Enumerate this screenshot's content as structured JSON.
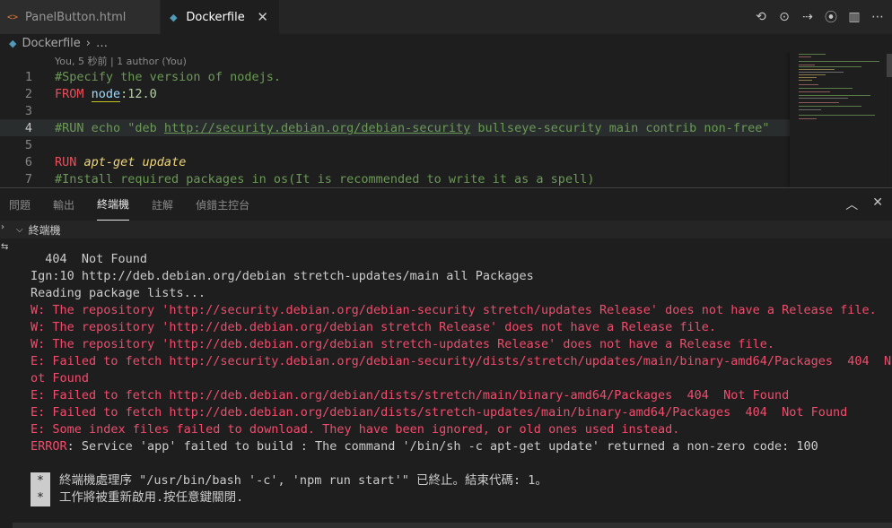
{
  "tabs": [
    {
      "label": "PanelButton.html",
      "icon": "html-icon",
      "active": false
    },
    {
      "label": "Dockerfile",
      "icon": "docker-icon",
      "active": true
    }
  ],
  "tab_close": "✕",
  "breadcrumb": {
    "file": "Dockerfile",
    "more": "…"
  },
  "editor": {
    "blame": "You, 5 秒前 | 1 author (You)",
    "line_numbers": [
      "1",
      "2",
      "3",
      "4",
      "5",
      "6",
      "7"
    ],
    "line1": "#Specify the version of nodejs.",
    "line2_kw": "FROM",
    "line2_image": "node",
    "line2_tag": ":12.0",
    "line4_pre": "#RUN echo \"deb ",
    "line4_link": "http://security.debian.org/debian-security",
    "line4_post": " bullseye-security main contrib non-free\"",
    "line6_kw": "RUN",
    "line6_cmd": "apt-get update",
    "line7": "#Install required packages in os(It is recommended to write it as a spell)"
  },
  "panel": {
    "tabs": [
      "問題",
      "輸出",
      "終端機",
      "註解",
      "偵錯主控台"
    ],
    "active_tab": "終端機",
    "terminal_title": "終端機"
  },
  "terminal": {
    "lines": [
      {
        "text": "  404  Not Found",
        "color": "white"
      },
      {
        "text": "Ign:10 http://deb.debian.org/debian stretch-updates/main all Packages",
        "color": "white"
      },
      {
        "text": "Reading package lists...",
        "color": "white"
      },
      {
        "text": "W: The repository 'http://security.debian.org/debian-security stretch/updates Release' does not have a Release file.",
        "color": "red"
      },
      {
        "text": "W: The repository 'http://deb.debian.org/debian stretch Release' does not have a Release file.",
        "color": "red"
      },
      {
        "text": "W: The repository 'http://deb.debian.org/debian stretch-updates Release' does not have a Release file.",
        "color": "red"
      },
      {
        "text": "E: Failed to fetch http://security.debian.org/debian-security/dists/stretch/updates/main/binary-amd64/Packages  404  N",
        "color": "red"
      },
      {
        "text": "ot Found",
        "color": "red"
      },
      {
        "text": "E: Failed to fetch http://deb.debian.org/debian/dists/stretch/main/binary-amd64/Packages  404  Not Found",
        "color": "red"
      },
      {
        "text": "E: Failed to fetch http://deb.debian.org/debian/dists/stretch-updates/main/binary-amd64/Packages  404  Not Found",
        "color": "red"
      },
      {
        "text": "E: Some index files failed to download. They have been ignored, or old ones used instead.",
        "color": "red"
      },
      {
        "text": "ERROR: Service 'app' failed to build : The command '/bin/sh -c apt-get update' returned a non-zero code: 100",
        "color": "white"
      },
      {
        "text": "",
        "color": "white"
      }
    ],
    "notices": [
      {
        "star": "*",
        "text": "終端機處理序 \"/usr/bin/bash '-c', 'npm run start'\" 已終止。結束代碼: 1。"
      },
      {
        "star": "*",
        "text": "工作將被重新啟用.按任意鍵關閉."
      }
    ],
    "error_prefix": "ERROR",
    "error_rest": ": Service 'app' failed to build : The command '/bin/sh -c apt-get update' returned a non-zero code: 100"
  },
  "colors": {
    "accent_red": "#f14c6c",
    "bg": "#1e1e1e"
  }
}
